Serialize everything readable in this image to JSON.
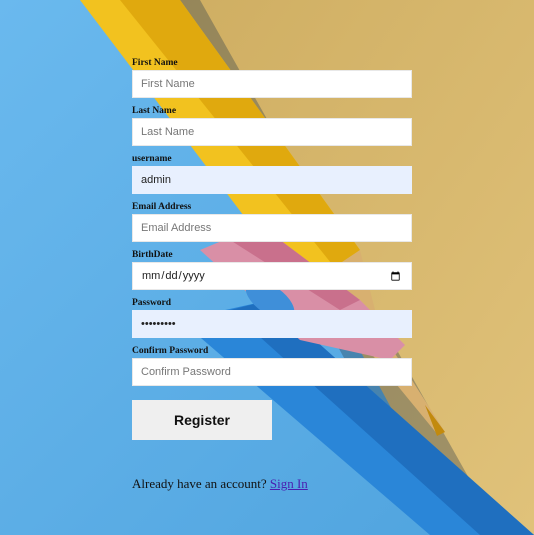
{
  "form": {
    "fields": [
      {
        "label": "First Name",
        "placeholder": "First Name",
        "value": ""
      },
      {
        "label": "Last Name",
        "placeholder": "Last Name",
        "value": ""
      },
      {
        "label": "username",
        "placeholder": "",
        "value": "admin"
      },
      {
        "label": "Email Address",
        "placeholder": "Email Address",
        "value": ""
      },
      {
        "label": "BirthDate",
        "placeholder": "mm/dd/yyyy",
        "value": ""
      },
      {
        "label": "Password",
        "placeholder": "",
        "value": "••••••••"
      },
      {
        "label": "Confirm Password",
        "placeholder": "Confirm Password",
        "value": ""
      }
    ],
    "register_label": "Register"
  },
  "footer": {
    "prompt": "Already have an account?",
    "sign_in_link": "Sign In"
  },
  "colors": {
    "background_blue": "#5fb4ea",
    "background_yellow": "#d9b86a",
    "autofill": "#e8f0fe",
    "link": "#4a1fb0"
  }
}
